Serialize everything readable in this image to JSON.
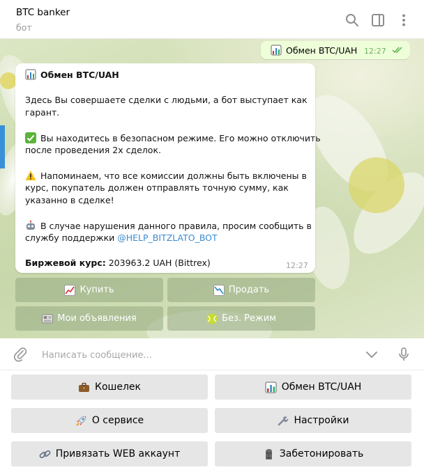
{
  "header": {
    "title": "BTC banker",
    "subtitle": "бот",
    "icons": [
      "search-icon",
      "sidebar-toggle-icon",
      "more-vertical-icon"
    ]
  },
  "outgoing": {
    "text": "Обмен BTC/UAH",
    "time": "12:27",
    "status": "read"
  },
  "message": {
    "title": "Обмен BTC/UAH",
    "lines": [
      "Здесь Вы совершаете сделки с людьми, а бот выступает как",
      "гарант.",
      "Вы находитесь в безопасном режиме. Его можно отключить",
      "после проведения 2х сделок.",
      "Напоминаем, что все комиссии должны быть включены в",
      "курс, покупатель должен отправлять точную сумму, как",
      "указанно в сделке!",
      "В случае нарушения данного правила, просим сообщить в",
      "службу поддержки "
    ],
    "support_link": "@HELP_BITZLATO_BOT",
    "rate_label": "Биржевой курс:",
    "rate_value": " 203963.2 UAH (Bittrex)",
    "time": "12:27"
  },
  "inline_buttons": [
    {
      "label": "Купить",
      "icon": "chart-up-icon"
    },
    {
      "label": "Продать",
      "icon": "chart-down-icon"
    },
    {
      "label": "Мои объявления",
      "icon": "newspaper-icon"
    },
    {
      "label": "Без. Режим",
      "icon": "tennis-ball-icon"
    }
  ],
  "input": {
    "placeholder": "Написать сообщение...",
    "value": ""
  },
  "keyboard": [
    {
      "label": "Кошелек",
      "icon": "briefcase-icon"
    },
    {
      "label": "Обмен BTC/UAH",
      "icon": "bar-chart-icon"
    },
    {
      "label": "О сервисе",
      "icon": "rocket-icon"
    },
    {
      "label": "Настройки",
      "icon": "wrench-icon"
    },
    {
      "label": "Привязать WEB аккаунт",
      "icon": "link-icon"
    },
    {
      "label": "Забетонировать",
      "icon": "moai-icon"
    }
  ],
  "colors": {
    "link": "#3a8bd1",
    "outgoing_bubble": "#eefed9",
    "read_check": "#5fb14f",
    "keyboard_button": "#e6e6e6"
  }
}
